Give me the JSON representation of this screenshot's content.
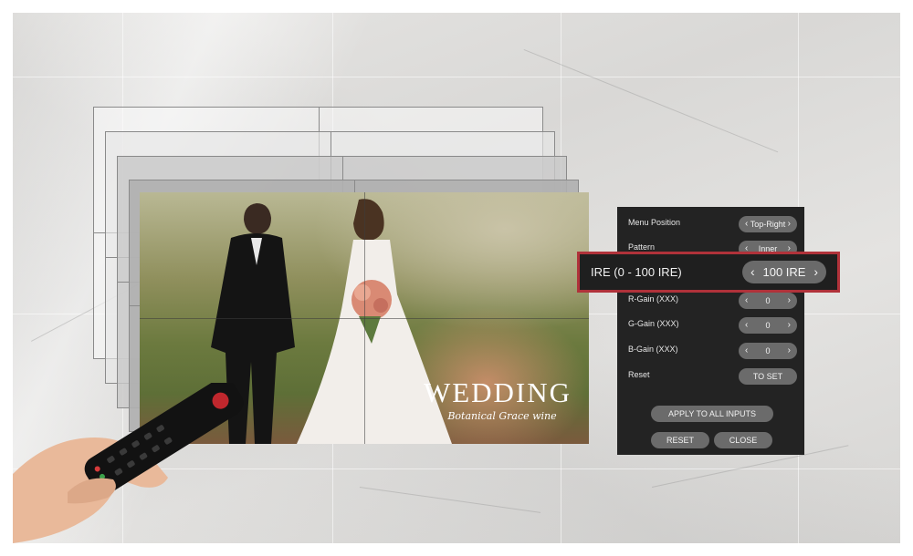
{
  "photo": {
    "title": "WEDDING",
    "subtitle": "Botanical Grace wine"
  },
  "osd": {
    "rows": [
      {
        "label": "Menu Position",
        "value": "Top-Right",
        "arrows": true
      },
      {
        "label": "Pattern",
        "value": "Inner",
        "arrows": true
      },
      {
        "label": "R-Gain (XXX)",
        "value": "0",
        "arrows": true
      },
      {
        "label": "G-Gain (XXX)",
        "value": "0",
        "arrows": true
      },
      {
        "label": "B-Gain (XXX)",
        "value": "0",
        "arrows": true
      },
      {
        "label": "Reset",
        "value": "TO SET",
        "arrows": false
      }
    ],
    "apply_label": "APPLY TO ALL INPUTS",
    "reset_label": "RESET",
    "close_label": "CLOSE"
  },
  "highlight": {
    "label": "IRE (0 - 100 IRE)",
    "value": "100 IRE"
  },
  "glyphs": {
    "left_arrow": "‹",
    "right_arrow": "›"
  },
  "colors": {
    "highlight_border": "#b0323a",
    "osd_background": "#232323",
    "osd_button": "#6b6b6b"
  }
}
